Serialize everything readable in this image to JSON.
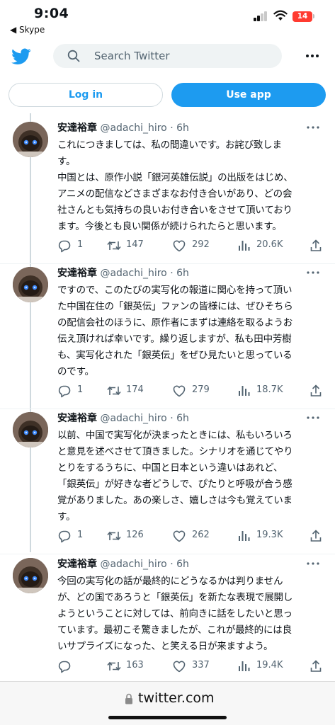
{
  "status": {
    "time": "9:04",
    "back_app": "◀ Skype",
    "battery": "14"
  },
  "header": {
    "search_placeholder": "Search Twitter"
  },
  "auth": {
    "login": "Log in",
    "use_app": "Use app"
  },
  "tweets": [
    {
      "name": "安達裕章",
      "handle": "@adachi_hiro",
      "dot": "·",
      "time": "6h",
      "lines": [
        "これにつきましては、私の間違いです。お詫び致しま",
        "す。",
        "中国とは、原作小説「銀河英雄伝説」の出版をはじめ、",
        "アニメの配信などさまざまなお付き合いがあり、どの会",
        "社さんとも気持ちの良いお付き合いをさせて頂いており",
        "ます。今後とも良い関係が続けられたらと思います。"
      ],
      "replies": "1",
      "retweets": "147",
      "likes": "292",
      "views": "20.6K"
    },
    {
      "name": "安達裕章",
      "handle": "@adachi_hiro",
      "dot": "·",
      "time": "6h",
      "lines": [
        "ですので、このたびの実写化の報道に関心を持って頂い",
        "た中国在住の「銀英伝」ファンの皆様には、ぜひそちら",
        "の配信会社のほうに、原作者にまずは連絡を取るようお",
        "伝え頂ければ幸いです。繰り返しますが、私も田中芳樹",
        "も、実写化された「銀英伝」をぜひ見たいと思っている",
        "のです。"
      ],
      "replies": "1",
      "retweets": "174",
      "likes": "279",
      "views": "18.7K"
    },
    {
      "name": "安達裕章",
      "handle": "@adachi_hiro",
      "dot": "·",
      "time": "6h",
      "lines": [
        "以前、中国で実写化が決まったときには、私もいろいろ",
        "と意見を述べさせて頂きました。シナリオを通じてやり",
        "とりをするうちに、中国と日本という違いはあれど、",
        "「銀英伝」が好きな者どうしで、ぴたりと呼吸が合う感",
        "覚がありました。あの楽しさ、嬉しさは今も覚えていま",
        "す。"
      ],
      "replies": "1",
      "retweets": "126",
      "likes": "262",
      "views": "19.3K"
    },
    {
      "name": "安達裕章",
      "handle": "@adachi_hiro",
      "dot": "·",
      "time": "6h",
      "lines": [
        "今回の実写化の話が最終的にどうなるかは判りません",
        "が、どの国であろうと「銀英伝」を新たな表現で展開し",
        "ようということに対しては、前向きに話をしたいと思っ",
        "ています。最初こそ驚きましたが、これが最終的には良",
        "いサプライズになった、と笑える日が来ますよう。"
      ],
      "replies": "",
      "retweets": "163",
      "likes": "337",
      "views": "19.4K"
    }
  ],
  "browser": {
    "url": "twitter.com"
  },
  "colors": {
    "accent": "#1d9bf0",
    "text": "#0f1419",
    "muted": "#536471",
    "border": "#cfd9de"
  },
  "icons": [
    "twitter-bird-icon",
    "search-icon",
    "more-icon",
    "reply-icon",
    "retweet-icon",
    "like-icon",
    "views-icon",
    "share-icon",
    "lock-icon"
  ]
}
